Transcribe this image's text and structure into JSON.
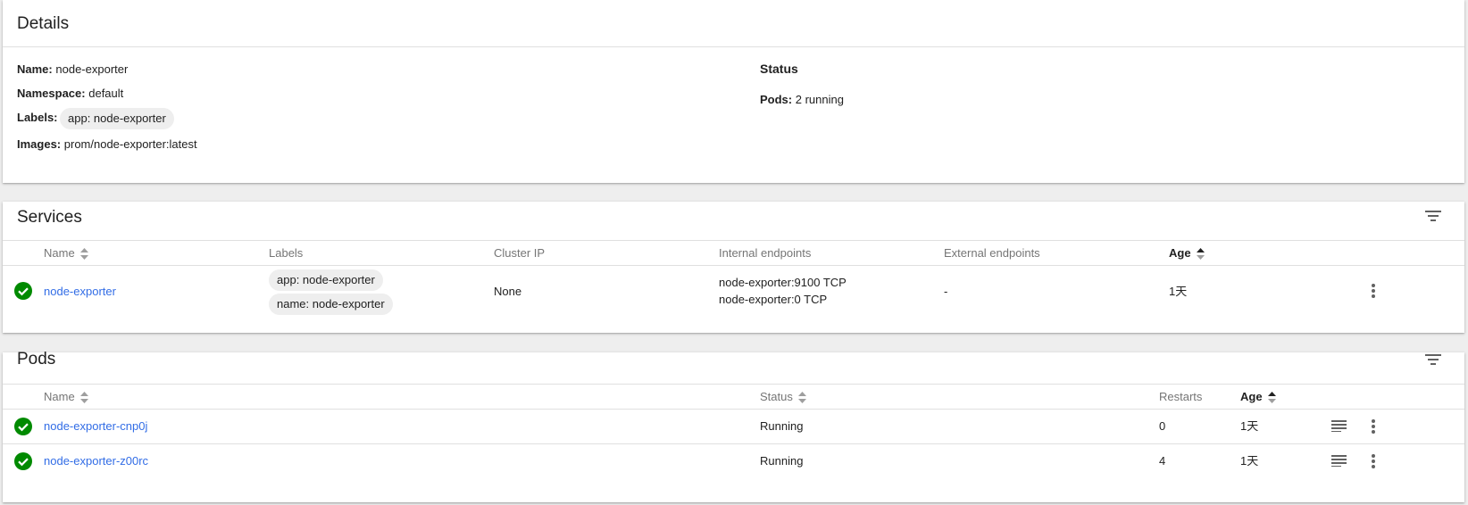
{
  "details": {
    "title": "Details",
    "name_label": "Name:",
    "name_value": "node-exporter",
    "namespace_label": "Namespace:",
    "namespace_value": "default",
    "labels_label": "Labels:",
    "labels": [
      "app: node-exporter"
    ],
    "images_label": "Images:",
    "images_value": "prom/node-exporter:latest",
    "status_title": "Status",
    "pods_label": "Pods:",
    "pods_value": "2 running"
  },
  "services": {
    "title": "Services",
    "columns": {
      "name": "Name",
      "labels": "Labels",
      "cluster_ip": "Cluster IP",
      "internal": "Internal endpoints",
      "external": "External endpoints",
      "age": "Age"
    },
    "rows": [
      {
        "name": "node-exporter",
        "labels": [
          "app: node-exporter",
          "name: node-exporter"
        ],
        "cluster_ip": "None",
        "internal": [
          "node-exporter:9100 TCP",
          "node-exporter:0 TCP"
        ],
        "external": "-",
        "age": "1天"
      }
    ]
  },
  "pods": {
    "title": "Pods",
    "columns": {
      "name": "Name",
      "status": "Status",
      "restarts": "Restarts",
      "age": "Age"
    },
    "rows": [
      {
        "name": "node-exporter-cnp0j",
        "status": "Running",
        "restarts": "0",
        "age": "1天"
      },
      {
        "name": "node-exporter-z00rc",
        "status": "Running",
        "restarts": "4",
        "age": "1天"
      }
    ]
  },
  "colors": {
    "link": "#326de6",
    "success": "#008a00",
    "icon": "#616161",
    "background": "#eeeeee"
  },
  "icons": [
    "check-circle-icon",
    "filter-icon",
    "sort-icon",
    "sort-ascending-icon",
    "more-vert-icon",
    "logs-icon"
  ]
}
